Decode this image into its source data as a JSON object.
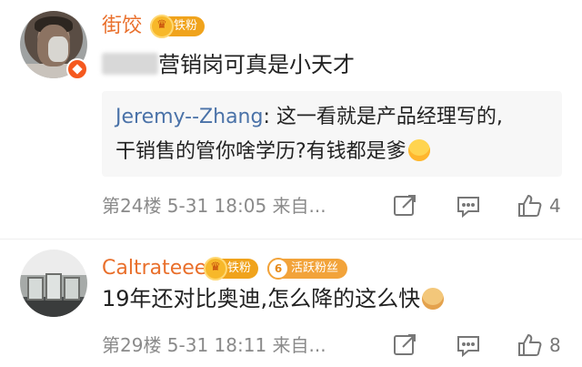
{
  "comments": [
    {
      "username": "街饺",
      "badges": {
        "fan": "铁粉"
      },
      "text": "营销岗可真是小天才",
      "quote": {
        "user": "Jeremy--Zhang",
        "line1": "这一看就是产品经理写的,",
        "line2": "干销售的管你啥学历?有钱都是爹"
      },
      "meta": "第24楼  5-31 18:05  来自...",
      "likes": "4"
    },
    {
      "username": "Caltrateee",
      "badges": {
        "fan": "铁粉",
        "active": "活跃粉丝",
        "active_level": "6"
      },
      "text": "19年还对比奥迪,怎么降的这么快",
      "meta": "第29楼  5-31 18:11  来自...",
      "likes": "8"
    }
  ],
  "icons": [
    "verified-badge-icon",
    "crown-icon",
    "share-icon",
    "reply-icon",
    "like-icon",
    "laugh-emoji-icon",
    "dog-emoji-icon"
  ],
  "colors": {
    "username": "#e96f2b",
    "quote_user": "#4a72a8",
    "meta": "#8a8a8a",
    "quote_bg": "#f7f7f7"
  }
}
